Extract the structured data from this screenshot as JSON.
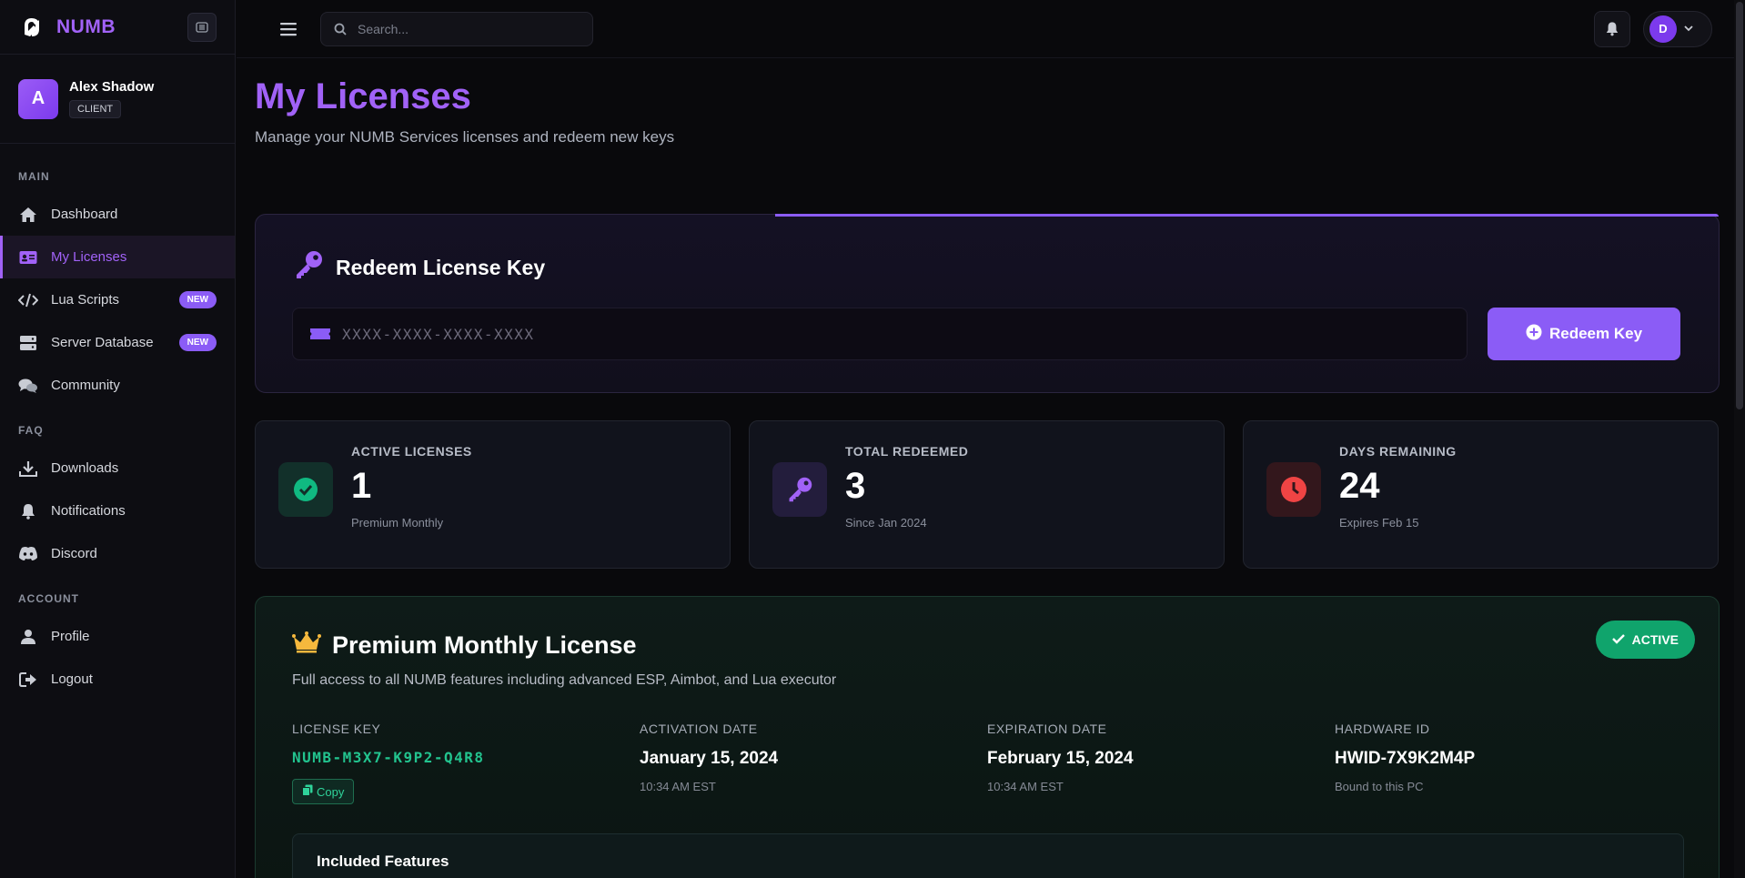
{
  "brand": {
    "name": "NUMB"
  },
  "user": {
    "initial": "A",
    "name": "Alex Shadow",
    "role": "CLIENT"
  },
  "sidebar": {
    "sections": [
      {
        "title": "MAIN"
      },
      {
        "title": "FAQ"
      },
      {
        "title": "ACCOUNT"
      }
    ],
    "items": [
      {
        "label": "Dashboard",
        "icon": "home-icon"
      },
      {
        "label": "My Licenses",
        "icon": "id-card-icon",
        "active": true
      },
      {
        "label": "Lua Scripts",
        "icon": "code-icon",
        "badge": "NEW"
      },
      {
        "label": "Server Database",
        "icon": "server-icon",
        "badge": "NEW"
      },
      {
        "label": "Community",
        "icon": "comments-icon"
      },
      {
        "label": "Downloads",
        "icon": "download-icon"
      },
      {
        "label": "Notifications",
        "icon": "bell-icon"
      },
      {
        "label": "Discord",
        "icon": "discord-icon"
      },
      {
        "label": "Profile",
        "icon": "user-icon"
      },
      {
        "label": "Logout",
        "icon": "logout-icon"
      }
    ]
  },
  "topbar": {
    "search_placeholder": "Search...",
    "profile_initial": "D"
  },
  "page": {
    "title": "My Licenses",
    "subtitle": "Manage your NUMB Services licenses and redeem new keys"
  },
  "redeem": {
    "title": "Redeem License Key",
    "placeholder": "XXXX-XXXX-XXXX-XXXX",
    "button_label": "Redeem Key"
  },
  "stats": [
    {
      "label": "ACTIVE LICENSES",
      "value": "1",
      "sub": "Premium Monthly",
      "icon": "check-circle-icon",
      "color": "#10b981"
    },
    {
      "label": "TOTAL REDEEMED",
      "value": "3",
      "sub": "Since Jan 2024",
      "icon": "key-icon",
      "color": "#8b5cf6"
    },
    {
      "label": "DAYS REMAINING",
      "value": "24",
      "sub": "Expires Feb 15",
      "icon": "clock-icon",
      "color": "#ef4444"
    }
  ],
  "license": {
    "title": "Premium Monthly License",
    "description": "Full access to all NUMB features including advanced ESP, Aimbot, and Lua executor",
    "status": "ACTIVE",
    "key_label": "LICENSE KEY",
    "key_value": "NUMB-M3X7-K9P2-Q4R8",
    "copy_label": "Copy",
    "activation_label": "ACTIVATION DATE",
    "activation_value": "January 15, 2024",
    "activation_time": "10:34 AM EST",
    "expiration_label": "EXPIRATION DATE",
    "expiration_value": "February 15, 2024",
    "expiration_time": "10:34 AM EST",
    "hwid_label": "HARDWARE ID",
    "hwid_value": "HWID-7X9K2M4P",
    "hwid_sub": "Bound to this PC",
    "features_title": "Included Features"
  },
  "colors": {
    "accent": "#a162f7",
    "success": "#10a46c",
    "danger": "#ef4444"
  }
}
